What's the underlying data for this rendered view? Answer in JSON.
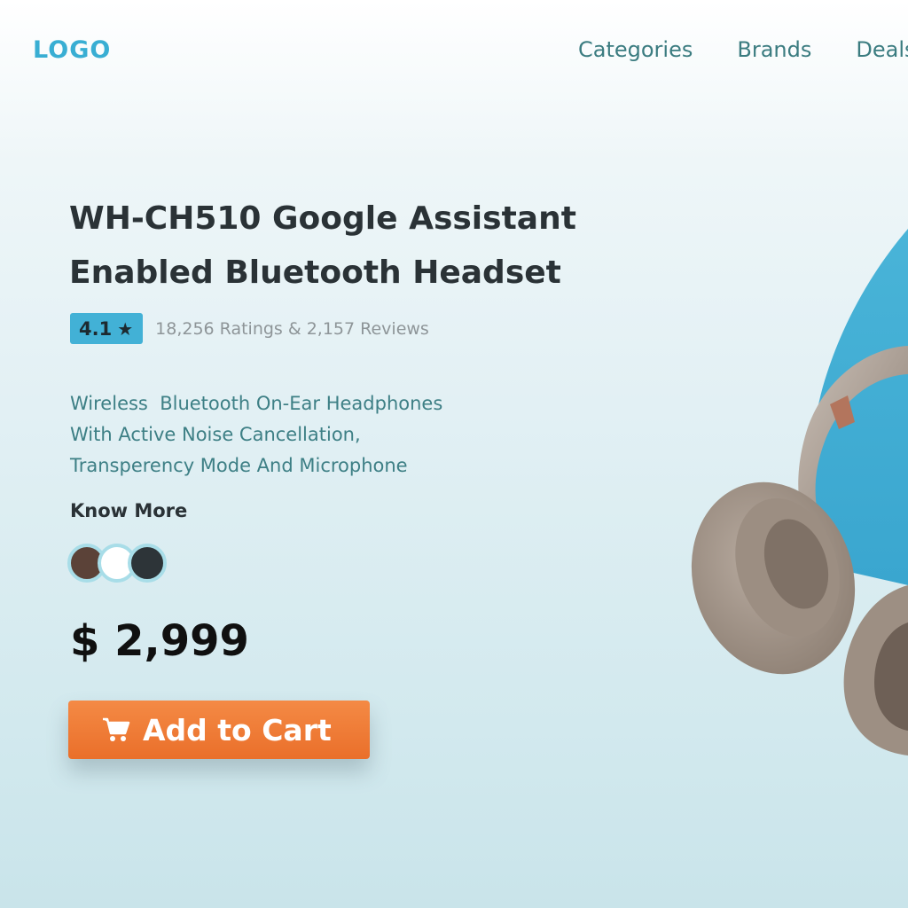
{
  "header": {
    "logo": "LOGO",
    "nav": [
      "Categories",
      "Brands",
      "Deals"
    ]
  },
  "product": {
    "title": "WH-CH510 Google Assistant Enabled Bluetooth Headset",
    "rating": "4.1",
    "rating_icon": "star-icon",
    "ratings_reviews": "18,256 Ratings & 2,157 Reviews",
    "description": [
      "Wireless  Bluetooth On-Ear Headphones",
      "With Active Noise Cancellation,",
      "Transperency Mode And Microphone"
    ],
    "know_more": "Know More",
    "color_options": [
      "#5b4238",
      "#ffffff",
      "#2d3438"
    ],
    "price": "$ 2,999",
    "add_to_cart": "Add to Cart",
    "cart_icon": "shopping-cart-icon"
  },
  "colors": {
    "accent": "#42b1d6",
    "cta": "#ee7833",
    "heading": "#2a3236",
    "body_text": "#3d7f85"
  }
}
